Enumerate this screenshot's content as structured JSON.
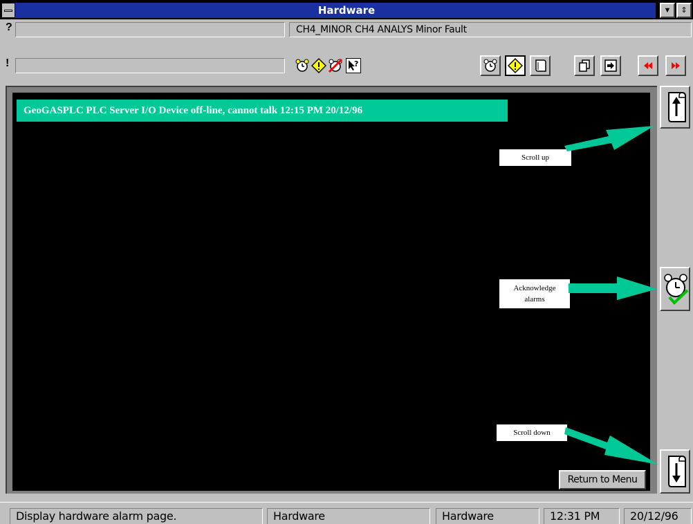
{
  "window": {
    "title": "Hardware"
  },
  "alarm_bar": {
    "current_alarm": "CH4_MINOR  CH4 ANALYS Minor Fault",
    "help_symbol": "?",
    "alert_symbol": "!"
  },
  "toolbar": {
    "small_icons": [
      "alarm-clock-icon",
      "warning-icon",
      "disabled-alarm-icon",
      "help-pointer-icon"
    ],
    "buttons": [
      "alarm-page-button",
      "warning-button",
      "scroll-page-button",
      "pages-button",
      "exit-button",
      "rewind-button",
      "fast-forward-button"
    ]
  },
  "display": {
    "alarm_message": "GeoGASPLC PLC Server I/O Device off-line, cannot talk 12:15 PM 20/12/96",
    "return_button": "Return to Menu"
  },
  "callouts": {
    "scroll_up": "Scroll up",
    "acknowledge_line1": "Acknowledge",
    "acknowledge_line2": "alarms",
    "scroll_down": "Scroll down"
  },
  "status_bar": {
    "message": "Display hardware alarm page.",
    "page": "Hardware",
    "area": "Hardware",
    "time": "12:31 PM",
    "date": "20/12/96"
  },
  "colors": {
    "title_bar": "#1a2fa0",
    "alarm_banner": "#00c896",
    "callout_arrow": "#00c896",
    "screen_background": "#000000"
  }
}
